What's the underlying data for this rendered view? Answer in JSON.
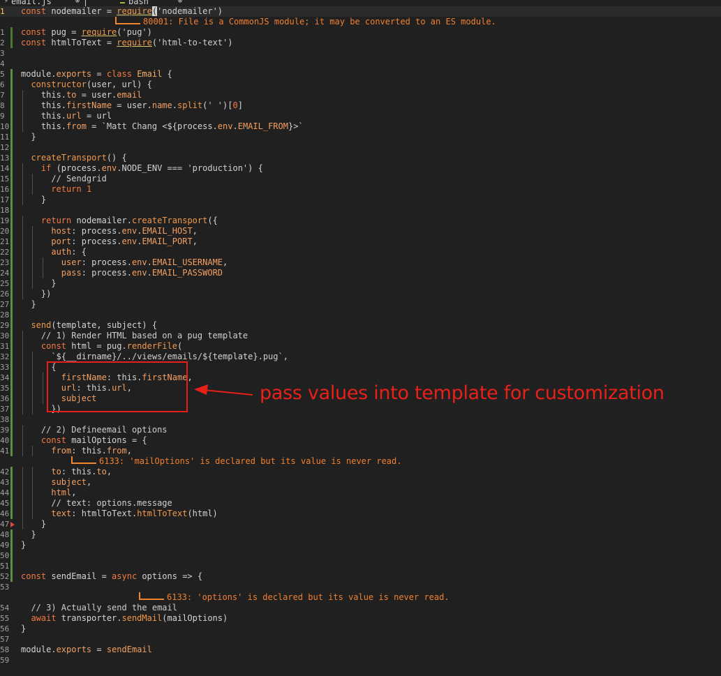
{
  "tabs": [
    {
      "label": "email.js",
      "icon": "js-file-icon"
    },
    {
      "label": "bash",
      "icon": "terminal-icon"
    }
  ],
  "colors": {
    "background": "#202020",
    "keyword": "#f47a42",
    "diagnostic": "#f08030",
    "annotation": "#e8201a",
    "git_added": "#5a9040"
  },
  "diagnostics": {
    "d1": "80001: File is a CommonJS module; it may be converted to an ES module.",
    "d2": "6133: 'mailOptions' is declared but its value is never read.",
    "d3": "6133: 'options' is declared but its value is never read."
  },
  "annotation": {
    "text": "pass values into template for customization"
  },
  "lines": [
    {
      "n": "1",
      "tokens": [
        [
          "kw",
          "const"
        ],
        [
          "p",
          " nodemailer = "
        ],
        [
          "req",
          "require"
        ],
        [
          "cursor",
          "("
        ],
        [
          "str",
          "'nodemailer'"
        ],
        [
          "p",
          ")"
        ]
      ]
    },
    {
      "n": "1",
      "tokens": [
        [
          "kw",
          "const"
        ],
        [
          "p",
          " pug = "
        ],
        [
          "req",
          "require"
        ],
        [
          "p",
          "("
        ],
        [
          "str",
          "'pug'"
        ],
        [
          "p",
          ")"
        ]
      ]
    },
    {
      "n": "2",
      "tokens": [
        [
          "kw",
          "const"
        ],
        [
          "p",
          " htmlToText = "
        ],
        [
          "req",
          "require"
        ],
        [
          "p",
          "("
        ],
        [
          "str",
          "'html-to-text'"
        ],
        [
          "p",
          ")"
        ]
      ]
    },
    {
      "n": "3",
      "tokens": []
    },
    {
      "n": "4",
      "tokens": []
    },
    {
      "n": "5",
      "tokens": [
        [
          "p",
          "module."
        ],
        [
          "prop",
          "exports"
        ],
        [
          "p",
          " = "
        ],
        [
          "kw",
          "class"
        ],
        [
          "p",
          " "
        ],
        [
          "cls",
          "Email"
        ],
        [
          "p",
          " {"
        ]
      ]
    },
    {
      "n": "6",
      "tokens": [
        [
          "p",
          "  "
        ],
        [
          "fn",
          "constructor"
        ],
        [
          "p",
          "(user, url) {"
        ]
      ]
    },
    {
      "n": "7",
      "tokens": [
        [
          "p",
          "    this."
        ],
        [
          "prop",
          "to"
        ],
        [
          "p",
          " = user."
        ],
        [
          "prop",
          "email"
        ]
      ]
    },
    {
      "n": "8",
      "tokens": [
        [
          "p",
          "    this."
        ],
        [
          "prop",
          "firstName"
        ],
        [
          "p",
          " = user."
        ],
        [
          "prop",
          "name"
        ],
        [
          "p",
          "."
        ],
        [
          "fn",
          "split"
        ],
        [
          "p",
          "("
        ],
        [
          "str",
          "' '"
        ],
        [
          "p",
          ")["
        ],
        [
          "num",
          "0"
        ],
        [
          "p",
          "]"
        ]
      ]
    },
    {
      "n": "9",
      "tokens": [
        [
          "p",
          "    this."
        ],
        [
          "prop",
          "url"
        ],
        [
          "p",
          " = url"
        ]
      ]
    },
    {
      "n": "10",
      "tokens": [
        [
          "p",
          "    this."
        ],
        [
          "prop",
          "from"
        ],
        [
          "p",
          " = "
        ],
        [
          "str",
          "`Matt Chang <"
        ],
        [
          "p",
          "${process."
        ],
        [
          "prop",
          "env"
        ],
        [
          "p",
          "."
        ],
        [
          "prop",
          "EMAIL_FROM"
        ],
        [
          "p",
          "}"
        ],
        [
          "str",
          ">`"
        ]
      ]
    },
    {
      "n": "11",
      "tokens": [
        [
          "p",
          "  }"
        ]
      ]
    },
    {
      "n": "12",
      "tokens": []
    },
    {
      "n": "13",
      "tokens": [
        [
          "p",
          "  "
        ],
        [
          "fn",
          "createTransport"
        ],
        [
          "p",
          "() {"
        ]
      ]
    },
    {
      "n": "14",
      "tokens": [
        [
          "p",
          "    "
        ],
        [
          "kw",
          "if"
        ],
        [
          "p",
          " (process."
        ],
        [
          "prop",
          "env"
        ],
        [
          "p",
          ".NODE_ENV === "
        ],
        [
          "str",
          "'production'"
        ],
        [
          "p",
          ") {"
        ]
      ]
    },
    {
      "n": "15",
      "tokens": [
        [
          "p",
          "      "
        ],
        [
          "cmt",
          "// Sendgrid"
        ]
      ]
    },
    {
      "n": "16",
      "tokens": [
        [
          "p",
          "      "
        ],
        [
          "kw",
          "return"
        ],
        [
          "p",
          " "
        ],
        [
          "num",
          "1"
        ]
      ]
    },
    {
      "n": "17",
      "tokens": [
        [
          "p",
          "    }"
        ]
      ]
    },
    {
      "n": "18",
      "tokens": []
    },
    {
      "n": "19",
      "tokens": [
        [
          "p",
          "    "
        ],
        [
          "kw",
          "return"
        ],
        [
          "p",
          " nodemailer."
        ],
        [
          "fn",
          "createTransport"
        ],
        [
          "p",
          "({"
        ]
      ]
    },
    {
      "n": "20",
      "tokens": [
        [
          "p",
          "      "
        ],
        [
          "prop",
          "host"
        ],
        [
          "p",
          ": process."
        ],
        [
          "prop",
          "env"
        ],
        [
          "p",
          "."
        ],
        [
          "prop",
          "EMAIL_HOST"
        ],
        [
          "p",
          ","
        ]
      ]
    },
    {
      "n": "21",
      "tokens": [
        [
          "p",
          "      "
        ],
        [
          "prop",
          "port"
        ],
        [
          "p",
          ": process."
        ],
        [
          "prop",
          "env"
        ],
        [
          "p",
          "."
        ],
        [
          "prop",
          "EMAIL_PORT"
        ],
        [
          "p",
          ","
        ]
      ]
    },
    {
      "n": "22",
      "tokens": [
        [
          "p",
          "      "
        ],
        [
          "prop",
          "auth"
        ],
        [
          "p",
          ": {"
        ]
      ]
    },
    {
      "n": "23",
      "tokens": [
        [
          "p",
          "        "
        ],
        [
          "prop",
          "user"
        ],
        [
          "p",
          ": process."
        ],
        [
          "prop",
          "env"
        ],
        [
          "p",
          "."
        ],
        [
          "prop",
          "EMAIL_USERNAME"
        ],
        [
          "p",
          ","
        ]
      ]
    },
    {
      "n": "24",
      "tokens": [
        [
          "p",
          "        "
        ],
        [
          "prop",
          "pass"
        ],
        [
          "p",
          ": process."
        ],
        [
          "prop",
          "env"
        ],
        [
          "p",
          "."
        ],
        [
          "prop",
          "EMAIL_PASSWORD"
        ]
      ]
    },
    {
      "n": "25",
      "tokens": [
        [
          "p",
          "      }"
        ]
      ]
    },
    {
      "n": "26",
      "tokens": [
        [
          "p",
          "    })"
        ]
      ]
    },
    {
      "n": "27",
      "tokens": [
        [
          "p",
          "  }"
        ]
      ]
    },
    {
      "n": "28",
      "tokens": []
    },
    {
      "n": "29",
      "tokens": [
        [
          "p",
          "  "
        ],
        [
          "fn",
          "send"
        ],
        [
          "p",
          "(template, subject) {"
        ]
      ]
    },
    {
      "n": "30",
      "tokens": [
        [
          "p",
          "    "
        ],
        [
          "cmt",
          "// 1) Render HTML based on a pug template"
        ]
      ]
    },
    {
      "n": "31",
      "tokens": [
        [
          "p",
          "    "
        ],
        [
          "kw",
          "const"
        ],
        [
          "p",
          " html = pug."
        ],
        [
          "fn",
          "renderFile"
        ],
        [
          "p",
          "("
        ]
      ]
    },
    {
      "n": "32",
      "tokens": [
        [
          "p",
          "      "
        ],
        [
          "str",
          "`"
        ],
        [
          "p",
          "${__dirname}"
        ],
        [
          "str",
          "/../views/emails/"
        ],
        [
          "p",
          "${template}"
        ],
        [
          "str",
          ".pug`"
        ],
        [
          "p",
          ","
        ]
      ]
    },
    {
      "n": "33",
      "tokens": [
        [
          "p",
          "      {"
        ]
      ]
    },
    {
      "n": "34",
      "tokens": [
        [
          "p",
          "        "
        ],
        [
          "prop",
          "firstName"
        ],
        [
          "p",
          ": this."
        ],
        [
          "prop",
          "firstName"
        ],
        [
          "p",
          ","
        ]
      ]
    },
    {
      "n": "35",
      "tokens": [
        [
          "p",
          "        "
        ],
        [
          "prop",
          "url"
        ],
        [
          "p",
          ": this."
        ],
        [
          "prop",
          "url"
        ],
        [
          "p",
          ","
        ]
      ]
    },
    {
      "n": "36",
      "tokens": [
        [
          "p",
          "        "
        ],
        [
          "prop",
          "subject"
        ]
      ]
    },
    {
      "n": "37",
      "tokens": [
        [
          "p",
          "      })"
        ]
      ]
    },
    {
      "n": "38",
      "tokens": []
    },
    {
      "n": "39",
      "tokens": [
        [
          "p",
          "    "
        ],
        [
          "cmt",
          "// 2) Defineemail options"
        ]
      ]
    },
    {
      "n": "40",
      "tokens": [
        [
          "p",
          "    "
        ],
        [
          "kw",
          "const"
        ],
        [
          "p",
          " mailOptions = {"
        ]
      ]
    },
    {
      "n": "41",
      "tokens": [
        [
          "p",
          "      "
        ],
        [
          "prop",
          "from"
        ],
        [
          "p",
          ": this."
        ],
        [
          "prop",
          "from"
        ],
        [
          "p",
          ","
        ]
      ]
    },
    {
      "n": "42",
      "tokens": [
        [
          "p",
          "      "
        ],
        [
          "prop",
          "to"
        ],
        [
          "p",
          ": this."
        ],
        [
          "prop",
          "to"
        ],
        [
          "p",
          ","
        ]
      ]
    },
    {
      "n": "43",
      "tokens": [
        [
          "p",
          "      "
        ],
        [
          "prop",
          "subject"
        ],
        [
          "p",
          ","
        ]
      ]
    },
    {
      "n": "44",
      "tokens": [
        [
          "p",
          "      "
        ],
        [
          "prop",
          "html"
        ],
        [
          "p",
          ","
        ]
      ]
    },
    {
      "n": "45",
      "tokens": [
        [
          "p",
          "      "
        ],
        [
          "cmt",
          "// text: options.message"
        ]
      ]
    },
    {
      "n": "46",
      "tokens": [
        [
          "p",
          "      "
        ],
        [
          "prop",
          "text"
        ],
        [
          "p",
          ": htmlToText."
        ],
        [
          "fn",
          "htmlToText"
        ],
        [
          "p",
          "(html)"
        ]
      ]
    },
    {
      "n": "47",
      "tokens": [
        [
          "p",
          "    }"
        ]
      ]
    },
    {
      "n": "48",
      "tokens": [
        [
          "p",
          "  }"
        ]
      ]
    },
    {
      "n": "49",
      "tokens": [
        [
          "p",
          "}"
        ]
      ]
    },
    {
      "n": "50",
      "tokens": []
    },
    {
      "n": "51",
      "tokens": []
    },
    {
      "n": "52",
      "tokens": [
        [
          "kw",
          "const"
        ],
        [
          "p",
          " sendEmail = "
        ],
        [
          "kw",
          "async"
        ],
        [
          "p",
          " options => {"
        ]
      ]
    },
    {
      "n": "53",
      "tokens": []
    },
    {
      "n": "54",
      "tokens": [
        [
          "p",
          "  "
        ],
        [
          "cmt",
          "// 3) Actually send the email"
        ]
      ]
    },
    {
      "n": "55",
      "tokens": [
        [
          "p",
          "  "
        ],
        [
          "kw",
          "await"
        ],
        [
          "p",
          " transporter."
        ],
        [
          "fn",
          "sendMail"
        ],
        [
          "p",
          "(mailOptions)"
        ]
      ]
    },
    {
      "n": "56",
      "tokens": [
        [
          "p",
          "}"
        ]
      ]
    },
    {
      "n": "57",
      "tokens": []
    },
    {
      "n": "58",
      "tokens": [
        [
          "p",
          "module."
        ],
        [
          "prop",
          "exports"
        ],
        [
          "p",
          " = "
        ],
        [
          "prop",
          "sendEmail"
        ]
      ]
    },
    {
      "n": "59",
      "tokens": []
    }
  ]
}
